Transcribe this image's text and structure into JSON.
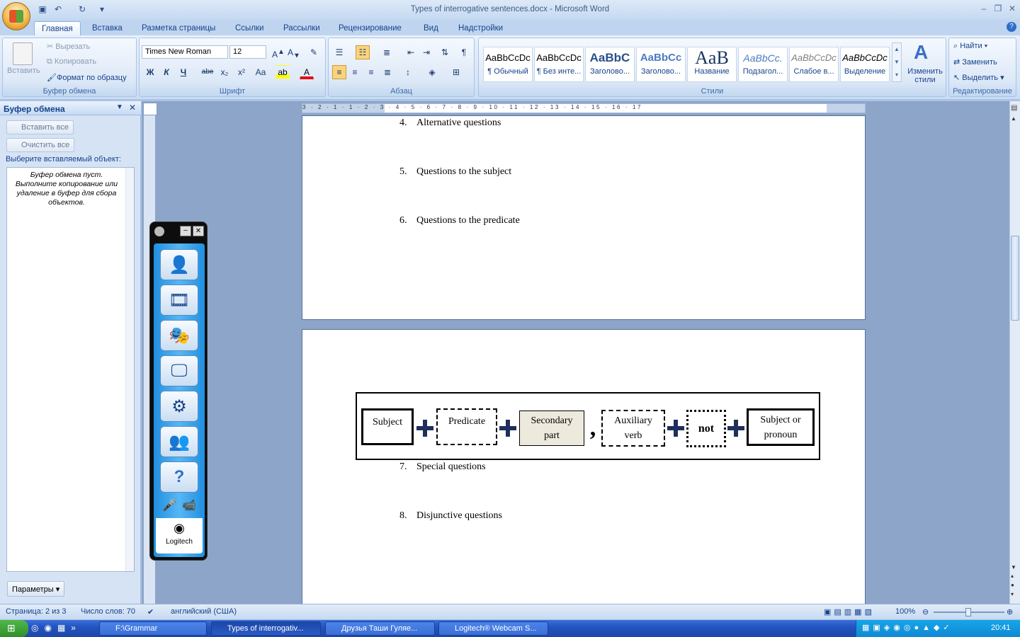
{
  "window": {
    "title": "Types of interrogative sentences.docx - Microsoft Word"
  },
  "tabs": [
    "Главная",
    "Вставка",
    "Разметка страницы",
    "Ссылки",
    "Рассылки",
    "Рецензирование",
    "Вид",
    "Надстройки"
  ],
  "ribbon": {
    "clipboard": {
      "label": "Буфер обмена",
      "paste": "Вставить",
      "cut": "Вырезать",
      "copy": "Копировать",
      "format_painter": "Формат по образцу"
    },
    "font": {
      "label": "Шрифт",
      "font_name": "Times New Roman",
      "font_size": "12",
      "bold": "Ж",
      "italic": "К",
      "underline": "Ч",
      "strike": "abe",
      "sub": "x₂",
      "sup": "x²",
      "case": "Aa"
    },
    "paragraph": {
      "label": "Абзац"
    },
    "styles": {
      "label": "Стили",
      "items": [
        {
          "sample": "AaBbCcDc",
          "name": "¶ Обычный"
        },
        {
          "sample": "AaBbCcDc",
          "name": "¶ Без инте..."
        },
        {
          "sample": "AaBbC",
          "name": "Заголово..."
        },
        {
          "sample": "AaBbCc",
          "name": "Заголово..."
        },
        {
          "sample": "AaB",
          "name": "Название"
        },
        {
          "sample": "AaBbCc.",
          "name": "Подзагол..."
        },
        {
          "sample": "AaBbCcDc",
          "name": "Слабое в..."
        },
        {
          "sample": "AaBbCcDc",
          "name": "Выделение"
        }
      ],
      "change_styles": "Изменить стили"
    },
    "editing": {
      "label": "Редактирование",
      "find": "Найти",
      "replace": "Заменить",
      "select": "Выделить"
    }
  },
  "clipboard_pane": {
    "title": "Буфер обмена",
    "paste_all": "Вставить все",
    "clear_all": "Очистить все",
    "select_label": "Выберите вставляемый объект:",
    "empty_msg": "Буфер обмена пуст. Выполните копирование или удаление в буфер для сбора объектов.",
    "options": "Параметры"
  },
  "ruler": {
    "marks": "3 · 2 · 1 · 1 · 2 · 3 · 4 · 5 · 6 · 7 · 8 · 9 · 10 · 11 · 12 · 13 · 14 · 15 · 16 · 17"
  },
  "document": {
    "page1": [
      {
        "num": "4.",
        "text": "Alternative questions"
      },
      {
        "num": "5.",
        "text": "Questions to the subject"
      },
      {
        "num": "6.",
        "text": "Questions to the predicate"
      }
    ],
    "diagram": {
      "subject": "Subject",
      "predicate": "Predicate",
      "secondary": "Secondary part",
      "comma": ",",
      "aux": "Auxiliary verb",
      "not": "not",
      "subject_pronoun": "Subject or pronoun"
    },
    "page2": [
      {
        "num": "7.",
        "text": "Special questions"
      },
      {
        "num": "8.",
        "text": "Disjunctive questions"
      }
    ]
  },
  "logitech": {
    "brand": "Logitech"
  },
  "status": {
    "page": "Страница: 2 из 3",
    "words": "Число слов: 70",
    "language": "английский (США)",
    "zoom": "100%"
  },
  "taskbar": {
    "items": [
      "F:\\Grammar",
      "Types of interrogativ...",
      "Друзья Таши Гуляе...",
      "Logitech® Webcam S..."
    ],
    "clock": "20:41"
  }
}
